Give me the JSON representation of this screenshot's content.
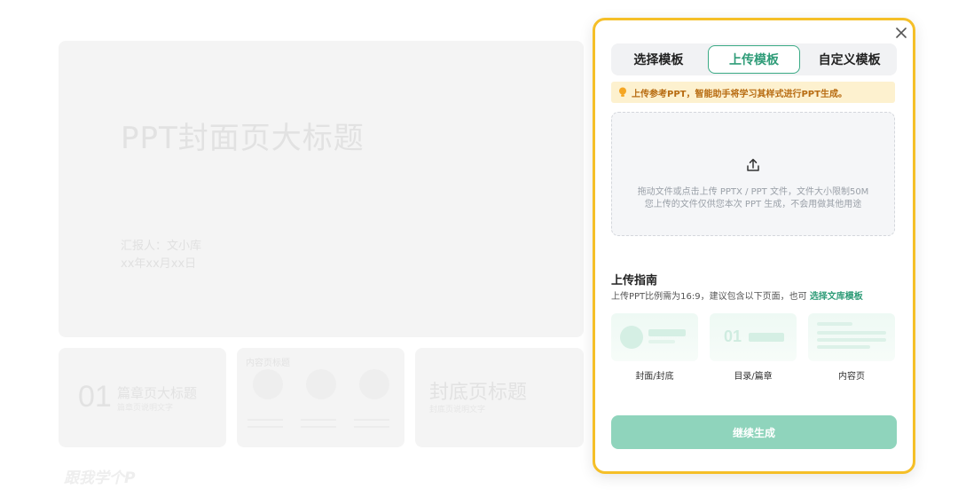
{
  "background": {
    "cover": {
      "title": "PPT封面页大标题",
      "reporter": "汇报人：文小库",
      "date": "xx年xx月xx日"
    },
    "chapter_thumb": {
      "number": "01",
      "title": "篇章页大标题",
      "subtitle": "篇章页说明文字"
    },
    "content_thumb": {
      "title": "内容页标题"
    },
    "back_thumb": {
      "title": "封底页标题",
      "subtitle": "封底页说明文字"
    },
    "watermark": "跟我学个P"
  },
  "modal": {
    "tabs": [
      {
        "label": "选择模板",
        "active": false
      },
      {
        "label": "上传模板",
        "active": true
      },
      {
        "label": "自定义模板",
        "active": false
      }
    ],
    "tip": "上传参考PPT，智能助手将学习其样式进行PPT生成。",
    "dropzone": {
      "line1": "拖动文件或点击上传 PPTX / PPT 文件，文件大小限制50M",
      "line2": "您上传的文件仅供您本次 PPT 生成，不会用做其他用途"
    },
    "guide": {
      "title": "上传指南",
      "desc": "上传PPT比例需为16:9，建议包含以下页面，也可",
      "link": "选择文库模板",
      "samples": [
        {
          "label": "封面/封底"
        },
        {
          "label": "目录/篇章"
        },
        {
          "label": "内容页"
        }
      ],
      "sample_number": "01"
    },
    "continue_label": "继续生成"
  },
  "colors": {
    "accent": "#2f9c78",
    "highlight_border": "#f5bf28",
    "tip_bg": "#fdf1cf",
    "button_bg": "#8fd4bc"
  },
  "icons": [
    "close-icon",
    "bulb-icon",
    "upload-icon"
  ]
}
